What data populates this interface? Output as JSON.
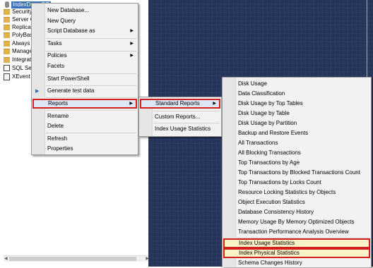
{
  "explorer": {
    "root_label": "IndexDemoDB",
    "items": [
      {
        "label": "Security",
        "icon": "folder-icon"
      },
      {
        "label": "Server O",
        "icon": "folder-icon"
      },
      {
        "label": "Replicat",
        "icon": "folder-icon"
      },
      {
        "label": "PolyBas",
        "icon": "folder-icon"
      },
      {
        "label": "Always (",
        "icon": "folder-icon"
      },
      {
        "label": "Manage",
        "icon": "folder-icon"
      },
      {
        "label": "Integrat",
        "icon": "folder-icon"
      },
      {
        "label": "SQL Ser",
        "icon": "sql-agent-icon"
      },
      {
        "label": "XEvent P",
        "icon": "xevent-profiler-icon"
      }
    ]
  },
  "context_menu": {
    "items": [
      "New Database...",
      "New Query",
      "Script Database as",
      "Tasks",
      "Policies",
      "Facets",
      "Start PowerShell",
      "Generate test data",
      "Reports",
      "Rename",
      "Delete",
      "Refresh",
      "Properties"
    ]
  },
  "reports_menu": {
    "items": [
      "Standard Reports",
      "Custom Reports...",
      "Index Usage Statistics"
    ]
  },
  "standard_reports_menu": {
    "items": [
      "Disk Usage",
      "Data Classification",
      "Disk Usage by Top Tables",
      "Disk Usage by Table",
      "Disk Usage by Partition",
      "Backup and Restore Events",
      "All Transactions",
      "All Blocking Transactions",
      "Top Transactions by Age",
      "Top Transactions by Blocked Transactions Count",
      "Top Transactions by Locks Count",
      "Resource Locking Statistics by Objects",
      "Object Execution Statistics",
      "Database Consistency History",
      "Memory Usage By Memory Optimized Objects",
      "Transaction Performance Analysis Overview",
      "Index Usage Statistics",
      "Index Physical Statistics",
      "Schema Changes History"
    ]
  },
  "colors": {
    "highlight_outline": "#d3201f",
    "selection": "#3a6fb7",
    "dark_background": "#26345a",
    "highlight_fill": "#fbf3c7"
  }
}
